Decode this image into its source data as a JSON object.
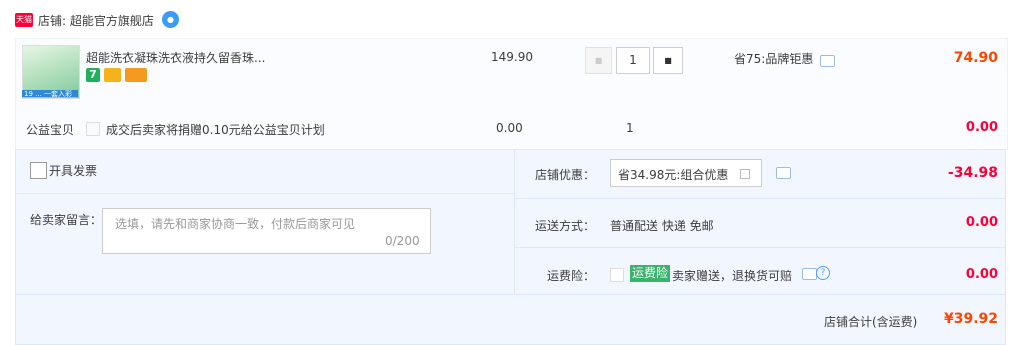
{
  "store": {
    "badge": "天猫",
    "name": "店铺: 超能官方旗舰店",
    "wangwang_icon": "chat-bubble-icon"
  },
  "item": {
    "title": "超能洗衣凝珠洗衣液持久留香珠...",
    "thumb_tag": "19 ... 一套入彩",
    "service_7": "7",
    "unit_price": "149.90",
    "quantity": "1",
    "promo": "省75:品牌钜惠",
    "total": "74.90"
  },
  "charity": {
    "label": "公益宝贝",
    "text": "成交后卖家将捐赠0.10元给公益宝贝计划",
    "price": "0.00",
    "qty": "1",
    "total": "0.00"
  },
  "form": {
    "invoice_label": "开具发票",
    "remark_label": "给卖家留言：",
    "remark_placeholder": "选填，请先和商家协商一致，付款后商家可见",
    "remark_count": "0/200",
    "discount_label": "店铺优惠：",
    "discount_value": "省34.98元:组合优惠",
    "discount_amount": "-34.98",
    "ship_label": "运送方式：",
    "ship_value": "普通配送 快递 免邮",
    "ship_amount": "0.00",
    "insurance_label": "运费险：",
    "insurance_tag": "运费险",
    "insurance_text": "卖家赠送，退换货可赔",
    "insurance_amount": "0.00",
    "sum_label": "店铺合计(含运费)",
    "sum_amount": "¥39.92"
  },
  "colors": {
    "price_orange": "#ff4400",
    "price_red": "#ff0036",
    "panel_bg": "#f2f7ff",
    "insurance_green": "#3ab36b"
  }
}
